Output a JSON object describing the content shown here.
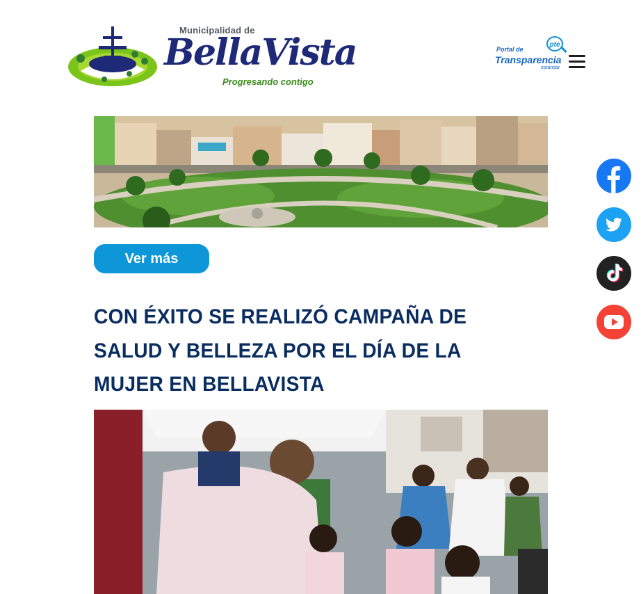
{
  "header": {
    "logo": {
      "small_text": "Municipalidad de",
      "big_text": "BellaVista",
      "tagline": "Progresando contigo"
    },
    "transparency": {
      "badge": "pte",
      "line1": "Portal de",
      "line2": "Transparencia",
      "line3": "estándar"
    },
    "menu_icon": "hamburger-icon"
  },
  "main": {
    "hero_image_alt": "plaza-aerial-photo",
    "more_button_label": "Ver más",
    "news_title": "CON ÉXITO SE REALIZÓ CAMPAÑA DE SALUD Y BELLEZA POR EL DÍA DE LA MUJER EN BELLAVISTA",
    "news_image_alt": "health-campaign-photo"
  },
  "social": [
    {
      "name": "facebook",
      "icon": "facebook-icon",
      "color": "#1877f2"
    },
    {
      "name": "twitter",
      "icon": "twitter-icon",
      "color": "#1da1f2"
    },
    {
      "name": "tiktok",
      "icon": "tiktok-icon",
      "color": "#222222"
    },
    {
      "name": "youtube",
      "icon": "youtube-icon",
      "color": "#f44336"
    }
  ],
  "colors": {
    "accent_blue": "#0d97d8",
    "title_navy": "#0a2d60",
    "brand_navy": "#1e2a78",
    "brand_green": "#3a8a1a"
  }
}
